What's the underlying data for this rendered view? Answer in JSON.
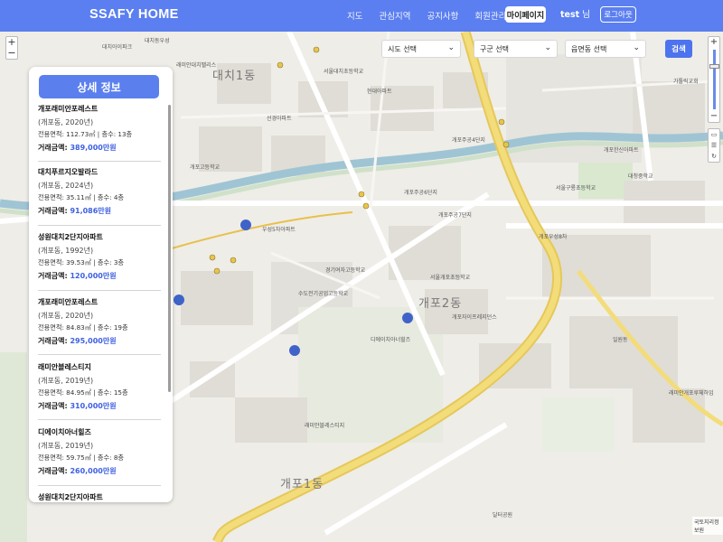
{
  "navbar": {
    "brand": "SSAFY HOME",
    "links": [
      "지도",
      "관심지역",
      "공지사항",
      "회원관리"
    ],
    "mypage": "마이페이지",
    "user_name": "test",
    "user_suffix": "님",
    "logout": "로그아웃"
  },
  "filters": {
    "sido": "시도 선택",
    "gugun": "구군 선택",
    "dong": "읍면동 선택",
    "search": "검색"
  },
  "map": {
    "zoom_in": "+",
    "zoom_out": "−",
    "dong_labels": [
      "대치1동",
      "개포2동",
      "개포1동"
    ],
    "place_labels": [
      "대치아이파크",
      "대치동우성",
      "래미안대치팰리스",
      "서울대치초등학교",
      "선경아파트",
      "현대아파트",
      "개포고등학교",
      "개포주공6단지",
      "개포주공7단지",
      "서울개포초등학교",
      "디에이치아너힐즈",
      "래미안블레스티지",
      "개포한신아파트",
      "우성5차아파트",
      "경기여자고등학교",
      "수도전기공업고등학교",
      "개포자이프레지던스",
      "달터공원",
      "서울구룡초등학교",
      "개포주공4단지",
      "일원동",
      "래미안개포루체하임",
      "개포우성8차",
      "대청중학교",
      "가톨릭교회"
    ],
    "copyright": "국토지리정보원"
  },
  "panel": {
    "title": "상세 정보",
    "items": [
      {
        "name": "개포래미안포레스트",
        "sub": "(개포동, 2020년)",
        "spec": "전용면적: 112.73㎡ | 층수: 13층",
        "price_label": "거래금액: ",
        "price": "389,000만원"
      },
      {
        "name": "대치푸르지오발라드",
        "sub": "(개포동, 2024년)",
        "spec": "전용면적: 35.11㎡ | 층수: 4층",
        "price_label": "거래금액: ",
        "price": "91,086만원"
      },
      {
        "name": "성원대치2단지아파트",
        "sub": "(개포동, 1992년)",
        "spec": "전용면적: 39.53㎡ | 층수: 3층",
        "price_label": "거래금액: ",
        "price": "120,000만원"
      },
      {
        "name": "개포래미안포레스트",
        "sub": "(개포동, 2020년)",
        "spec": "전용면적: 84.83㎡ | 층수: 19층",
        "price_label": "거래금액: ",
        "price": "295,000만원"
      },
      {
        "name": "래미안블레스티지",
        "sub": "(개포동, 2019년)",
        "spec": "전용면적: 84.95㎡ | 층수: 15층",
        "price_label": "거래금액: ",
        "price": "310,000만원"
      },
      {
        "name": "디에이치아너힐즈",
        "sub": "(개포동, 2019년)",
        "spec": "전용면적: 59.75㎡ | 층수: 8층",
        "price_label": "거래금액: ",
        "price": "260,000만원"
      },
      {
        "name": "성원대치2단지아파트",
        "sub": "",
        "spec": "",
        "price_label": "",
        "price": ""
      }
    ]
  },
  "colors": {
    "nav": "#5b7ff0",
    "accent": "#4e73ee",
    "price": "#3d5fe0",
    "main_road": "#f0d46a",
    "stream": "#9fc5d4",
    "marker": "#3f63c8"
  }
}
